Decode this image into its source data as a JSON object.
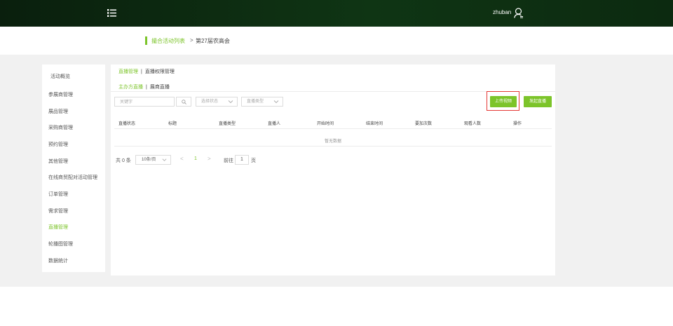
{
  "header": {
    "menu_icon": "list-icon",
    "username": "zhuban",
    "user_icon": "user-icon",
    "bg_color": "#0f3514"
  },
  "breadcrumb": {
    "parent": "撮合活动列表",
    "separator": ">",
    "current": "第27届农高会"
  },
  "sidebar": {
    "items": [
      {
        "label": "活动概览",
        "active": false
      },
      {
        "label": "参展商管理",
        "active": false
      },
      {
        "label": "展品管理",
        "active": false
      },
      {
        "label": "采购商管理",
        "active": false
      },
      {
        "label": "预约管理",
        "active": false
      },
      {
        "label": "其他管理",
        "active": false
      },
      {
        "label": "在线商贸配对活动管理",
        "active": false
      },
      {
        "label": "订单管理",
        "active": false
      },
      {
        "label": "需求管理",
        "active": false
      },
      {
        "label": "直播管理",
        "active": true
      },
      {
        "label": "轮播图管理",
        "active": false
      },
      {
        "label": "数据统计",
        "active": false
      }
    ]
  },
  "main": {
    "primary_tabs": [
      {
        "label": "直播管理",
        "active": true
      },
      {
        "label": "直播权限管理",
        "active": false
      }
    ],
    "secondary_tabs": [
      {
        "label": "主办方直播",
        "active": true
      },
      {
        "label": "展商直播",
        "active": false
      }
    ],
    "tab_separator": "|",
    "filters": {
      "keyword_placeholder": "关键字",
      "search_icon": "search-icon",
      "status_placeholder": "选择状态",
      "type_placeholder": "直播类型"
    },
    "buttons": {
      "upload_video": "上传视频",
      "start_live": "发起直播"
    },
    "accent_color": "#7cc42a",
    "highlight_color": "#e53935",
    "table": {
      "columns": [
        "直播状态",
        "标题",
        "直播类型",
        "直播人",
        "开始时间",
        "结束时间",
        "要加次数",
        "观看人数",
        "操作"
      ],
      "rows": [],
      "empty_text": "暂无数据"
    },
    "pagination": {
      "total_text": "共 0 条",
      "page_size": "10条/页",
      "prev": "<",
      "next": ">",
      "current_page": "1",
      "goto_label": "前往",
      "goto_value": "1",
      "page_unit": "页"
    }
  }
}
